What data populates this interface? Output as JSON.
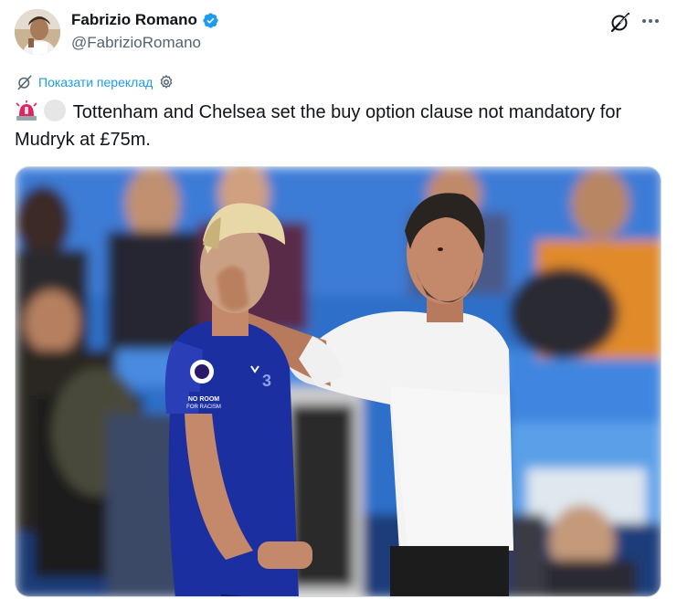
{
  "author": {
    "display_name": "Fabrizio Romano",
    "handle": "@FabrizioRomano",
    "verified": true,
    "avatar_icon": "profile-photo"
  },
  "actions": {
    "grok_icon": "grok-slash-icon",
    "more_icon": "more-dots-icon"
  },
  "translate": {
    "label": "Показати переклад",
    "icon": "translate-icon",
    "settings_icon": "gear-icon"
  },
  "tweet": {
    "emoji_1": "rotating-light",
    "emoji_2": "white-circle",
    "text": "Tottenham and Chelsea set the buy option clause not mandatory for Mudryk at £75m."
  },
  "media": {
    "kit_badge_text": "No room for racism",
    "colors": {
      "kit_blue": "#1c2fa0",
      "stand_blue": "#2e6fc9",
      "shirt_white": "#f3f3f3",
      "accent": "#1d9bf0"
    }
  }
}
